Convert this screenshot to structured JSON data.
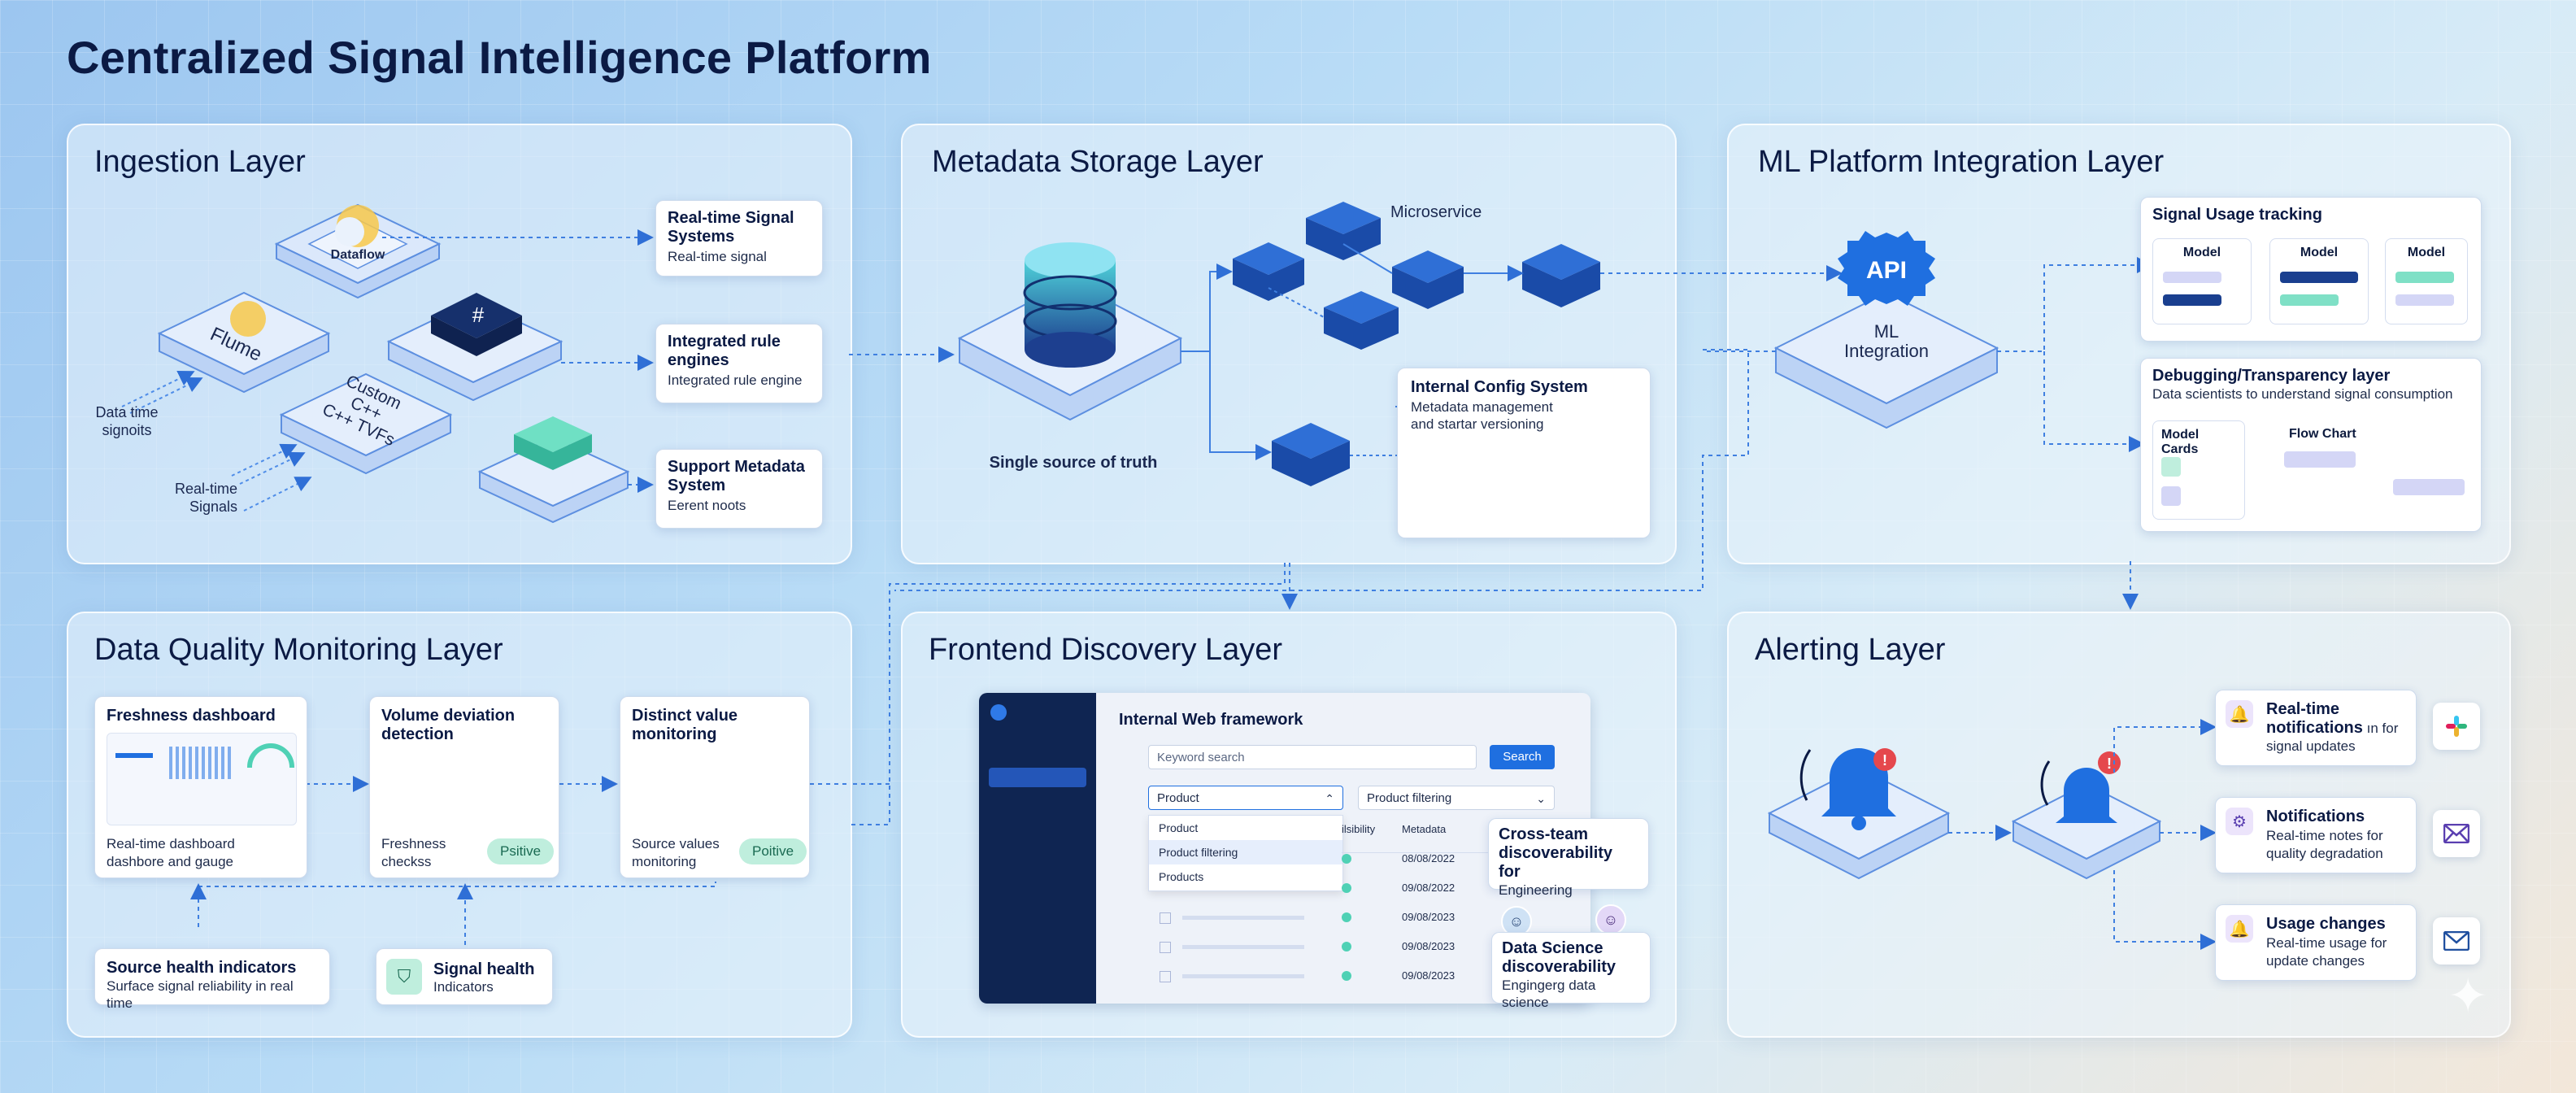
{
  "title": "Centralized Signal Intelligence Platform",
  "ingestion": {
    "title": "Ingestion Layer",
    "nodes": {
      "dataflow": "Dataflow",
      "flume": "Flume",
      "custom_line1": "Custom",
      "custom_line2": "C++",
      "custom_line3": "C++ TVFs"
    },
    "inputs": {
      "data_time": "Data time",
      "signoits": "signoits",
      "realtime": "Real-time",
      "signals": "Signals"
    },
    "cards": [
      {
        "title": "Real-time Signal Systems",
        "sub": "Real-time signal"
      },
      {
        "title": "Integrated rule engines",
        "sub": "Integrated rule engine"
      },
      {
        "title": "Support Metadata System",
        "sub": "Eerent noots"
      }
    ]
  },
  "metadata": {
    "title": "Metadata Storage Layer",
    "db_label": "Single source of truth",
    "microservice": "Microservice",
    "config": {
      "title": "Internal Config System",
      "sub_line1": "Metadata management",
      "sub_line2": "and startar versioning"
    }
  },
  "ml": {
    "title": "ML Platform Integration Layer",
    "api": "API",
    "node_line1": "ML",
    "node_line2": "Integration",
    "usage": {
      "title": "Signal Usage tracking",
      "model_label": "Model"
    },
    "debug": {
      "title": "Debugging/Transparency layer",
      "sub": "Data scientists to understand signal consumption",
      "model_cards": "Model Cards",
      "flow_chart": "Flow Chart"
    }
  },
  "quality": {
    "title": "Data Quality Monitoring Layer",
    "freshness": {
      "title": "Freshness dashboard",
      "sub_line1": "Real-time dashboard",
      "sub_line2": "dashbore and gauge"
    },
    "volume": {
      "title_line1": "Volume deviation",
      "title_line2": "detection",
      "sub_line1": "Freshness",
      "sub_line2": "checkss",
      "pill": "Psitive"
    },
    "distinct": {
      "title_line1": "Distinct value",
      "title_line2": "monitoring",
      "sub_line1": "Source values",
      "sub_line2": "monitoring",
      "pill": "Poitive"
    },
    "source_health": {
      "title": "Source health indicators",
      "sub": "Surface signal reliability in real time"
    },
    "signal_health": {
      "title": "Signal health",
      "sub": "Indicators"
    }
  },
  "frontend": {
    "title": "Frontend Discovery Layer",
    "framework": "Internal Web framework",
    "search_placeholder": "Keyword search",
    "search_button": "Search",
    "dropdown_selected": "Product",
    "dropdown_options": [
      "Product",
      "Product filtering",
      "Products"
    ],
    "filter2": "Product filtering",
    "col_visibility": "ilsibility",
    "col_metadata": "Metadata",
    "dates": [
      "08/08/2022",
      "09/08/2022",
      "09/08/2023",
      "09/08/2023",
      "09/08/2023"
    ],
    "crossteam": {
      "title_line1": "Cross-team",
      "title_line2": "discoverability for",
      "sub": "Engineering"
    },
    "datasci": {
      "title_line1": "Data Science",
      "title_line2": "discoverability",
      "sub": "Engingerg data science"
    }
  },
  "alerting": {
    "title": "Alerting Layer",
    "cards": [
      {
        "title_line1": "Real-time",
        "title_line2": "notifications",
        "title_suffix": " ın for",
        "sub": "signal updates"
      },
      {
        "title_line1": "Notifications",
        "sub_line1": "Real-time notes for",
        "sub_line2": "quality degradation"
      },
      {
        "title_line1": "Usage changes",
        "sub_line1": "Real-time usage for",
        "sub_line2": "update changes"
      }
    ]
  },
  "colors": {
    "accent": "#1f6fe0",
    "navy": "#0b1a44",
    "teal": "#4fd1b5",
    "alert": "#e5484d"
  }
}
